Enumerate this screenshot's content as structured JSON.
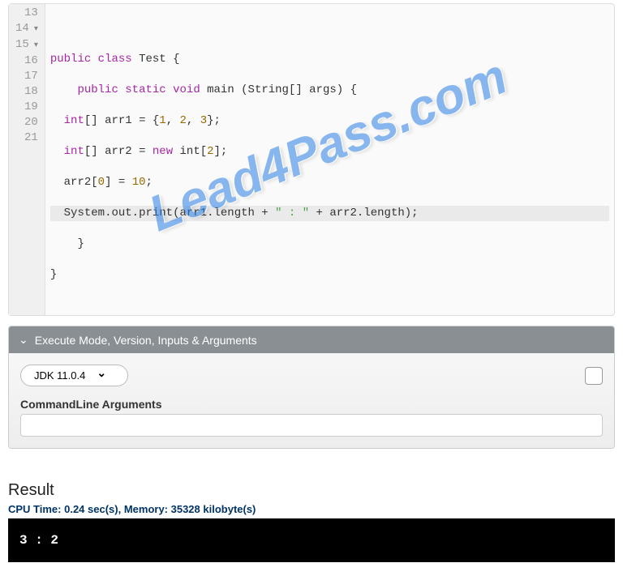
{
  "code": {
    "line_numbers": [
      "13",
      "14",
      "15",
      "16",
      "17",
      "18",
      "19",
      "20",
      "21"
    ],
    "lines": {
      "l13": "",
      "l14_kw1": "public",
      "l14_kw2": "class",
      "l14_ident": "Test",
      "l14_tail": "{",
      "l15_kw1": "public",
      "l15_kw2": "static",
      "l15_kw3": "void",
      "l15_method": "main",
      "l15_rest": "(String[] args) {",
      "l16_type": "int",
      "l16_rest1": "[] arr1 = {",
      "l16_n1": "1",
      "l16_n2": "2",
      "l16_n3": "3",
      "l16_rest2": "};",
      "l17_type": "int",
      "l17_rest1": "[] arr2 = ",
      "l17_kw": "new",
      "l17_rest2": " int[",
      "l17_n": "2",
      "l17_rest3": "];",
      "l18_a": "arr2[",
      "l18_i": "0",
      "l18_b": "] = ",
      "l18_v": "10",
      "l18_c": ";",
      "l19_a": "System.out.print(arr1.length + ",
      "l19_s": "\" : \"",
      "l19_b": " + arr2.length);",
      "l20": "    }",
      "l21": "}"
    }
  },
  "exec": {
    "header": "Execute Mode, Version, Inputs & Arguments",
    "jdk": "JDK 11.0.4",
    "cmd_label": "CommandLine Arguments",
    "cmd_value": ""
  },
  "result": {
    "label": "Result",
    "cpu": "CPU Time: 0.24 sec(s), Memory: 35328 kilobyte(s)",
    "output": "3 : 2"
  },
  "watermark": "Lead4Pass.com"
}
